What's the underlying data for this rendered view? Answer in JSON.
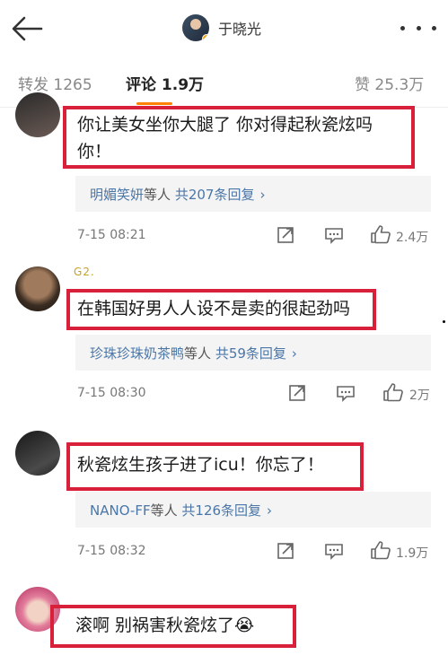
{
  "header": {
    "profile_name": "于晓光",
    "icons": {
      "back": "back-arrow-icon",
      "more": "more-dots-icon",
      "verified": "verified-badge-icon"
    }
  },
  "tabs": {
    "repost": "转发 1265",
    "comment": "评论 1.9万",
    "like": "赞 25.3万"
  },
  "colors": {
    "accent": "#ff8200",
    "highlight_box": "#d9203a",
    "link": "#4a76a8"
  },
  "comments": [
    {
      "text": "你让美女坐你大腿了 你对得起秋瓷炫吗你！",
      "reply_users": "明媚笑妍",
      "reply_mid": "等人",
      "reply_count": "共207条回复",
      "time": "7-15 08:21",
      "likes": "2.4万"
    },
    {
      "text": "在韩国好男人人设不是卖的很起劲吗",
      "tag": "G2.",
      "reply_users": "珍珠珍珠奶茶鸭",
      "reply_mid": "等人",
      "reply_count": "共59条回复",
      "time": "7-15 08:30",
      "likes": "2万"
    },
    {
      "text": "秋瓷炫生孩子进了icu！你忘了！",
      "reply_users": "NANO-FF",
      "reply_mid": "等人",
      "reply_count": "共126条回复",
      "time": "7-15 08:32",
      "likes": "1.9万"
    },
    {
      "text": "滚啊 别祸害秋瓷炫了😭"
    }
  ]
}
